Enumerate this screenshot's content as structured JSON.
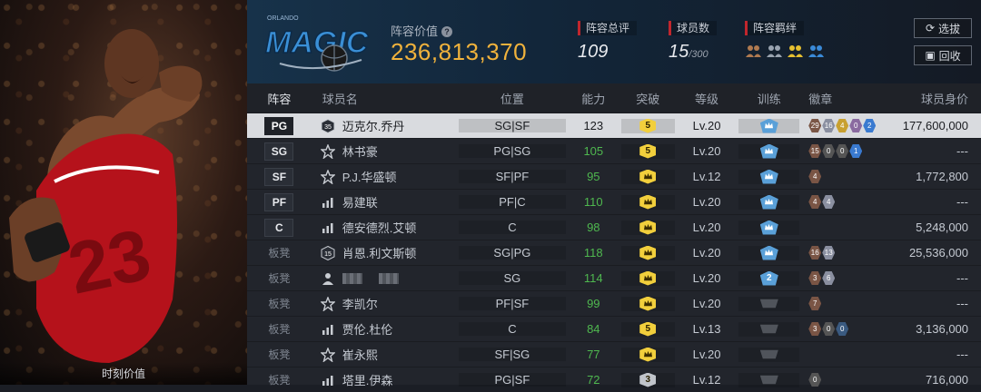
{
  "left_panel": {
    "moment_label": "时刻价值"
  },
  "header": {
    "team_value_label": "阵容价值",
    "team_value": "236,813,370",
    "rating_label": "阵容总评",
    "rating": "109",
    "players_label": "球员数",
    "players_count": "15",
    "players_max": "/300",
    "bonds_label": "阵容羁绊",
    "select_button": "选拔",
    "recycle_button": "回收",
    "logo_text": "MAGIC"
  },
  "table": {
    "headers": [
      "阵容",
      "球员名",
      "位置",
      "能力",
      "突破",
      "等级",
      "训练",
      "徽章",
      "球员身价"
    ],
    "rows": [
      {
        "slot": "PG",
        "name": "迈克尔.乔丹",
        "pos": "SG|SF",
        "ability": "123",
        "breakthrough": "5",
        "level": "Lv.20",
        "training": "crown",
        "badges": [
          {
            "c": "#7a5545",
            "n": "29"
          },
          {
            "c": "#8a8fa0",
            "n": "16"
          },
          {
            "c": "#c8a030",
            "n": "4"
          },
          {
            "c": "#8a6aa0",
            "n": "0"
          },
          {
            "c": "#3a7ad0",
            "n": "2"
          }
        ],
        "salary": "177,600,000",
        "icon": "35",
        "selected": true
      },
      {
        "slot": "SG",
        "name": "林书豪",
        "pos": "PG|SG",
        "ability": "105",
        "breakthrough": "5",
        "level": "Lv.20",
        "training": "crown",
        "badges": [
          {
            "c": "#7a5545",
            "n": "15"
          },
          {
            "c": "#555",
            "n": "0"
          },
          {
            "c": "#555",
            "n": "0"
          },
          {
            "c": "#3a7ad0",
            "n": "1"
          }
        ],
        "salary": "---",
        "icon": "star"
      },
      {
        "slot": "SF",
        "name": "P.J.华盛顿",
        "pos": "SF|PF",
        "ability": "95",
        "breakthrough": "crown",
        "level": "Lv.12",
        "training": "crown",
        "badges": [
          {
            "c": "#7a5545",
            "n": "4"
          }
        ],
        "salary": "1,772,800",
        "icon": "star"
      },
      {
        "slot": "PF",
        "name": "易建联",
        "pos": "PF|C",
        "ability": "110",
        "breakthrough": "crown",
        "level": "Lv.20",
        "training": "crown",
        "badges": [
          {
            "c": "#7a5545",
            "n": "4"
          },
          {
            "c": "#8a8fa0",
            "n": "4"
          }
        ],
        "salary": "---",
        "icon": "bars"
      },
      {
        "slot": "C",
        "name": "德安德烈.艾顿",
        "pos": "C",
        "ability": "98",
        "breakthrough": "crown",
        "level": "Lv.20",
        "training": "crown",
        "badges": [],
        "salary": "5,248,000",
        "icon": "bars"
      },
      {
        "slot": "板凳",
        "name": "肖恩.利文斯顿",
        "pos": "SG|PG",
        "ability": "118",
        "breakthrough": "crown",
        "level": "Lv.20",
        "training": "crown",
        "badges": [
          {
            "c": "#7a5545",
            "n": "16"
          },
          {
            "c": "#8a8fa0",
            "n": "13"
          }
        ],
        "salary": "25,536,000",
        "icon": "15"
      },
      {
        "slot": "板凳",
        "name": "",
        "pos": "SG",
        "ability": "114",
        "breakthrough": "crown",
        "level": "Lv.20",
        "training": "2",
        "badges": [
          {
            "c": "#7a5545",
            "n": "3"
          },
          {
            "c": "#8a8fa0",
            "n": "6"
          }
        ],
        "salary": "---",
        "icon": "person"
      },
      {
        "slot": "板凳",
        "name": "李凯尔",
        "pos": "PF|SF",
        "ability": "99",
        "breakthrough": "crown",
        "level": "Lv.20",
        "training": "gray",
        "badges": [
          {
            "c": "#7a5545",
            "n": "7"
          }
        ],
        "salary": "---",
        "icon": "star"
      },
      {
        "slot": "板凳",
        "name": "贾伦.杜伦",
        "pos": "C",
        "ability": "84",
        "breakthrough": "5",
        "level": "Lv.13",
        "training": "gray",
        "badges": [
          {
            "c": "#7a5545",
            "n": "3"
          },
          {
            "c": "#555",
            "n": "0"
          },
          {
            "c": "#3a5a80",
            "n": "0"
          }
        ],
        "salary": "3,136,000",
        "icon": "bars"
      },
      {
        "slot": "板凳",
        "name": "崔永熙",
        "pos": "SF|SG",
        "ability": "77",
        "breakthrough": "crown",
        "level": "Lv.20",
        "training": "gray",
        "badges": [],
        "salary": "---",
        "icon": "star"
      },
      {
        "slot": "板凳",
        "name": "塔里.伊森",
        "pos": "PG|SF",
        "ability": "72",
        "breakthrough": "3",
        "level": "Lv.12",
        "training": "gray",
        "badges": [
          {
            "c": "#555",
            "n": "0"
          }
        ],
        "salary": "716,000",
        "icon": "bars"
      }
    ]
  },
  "colors": {
    "accent_gold": "#f0b23c",
    "green": "#4fb84f",
    "red_marker": "#c0262d"
  }
}
